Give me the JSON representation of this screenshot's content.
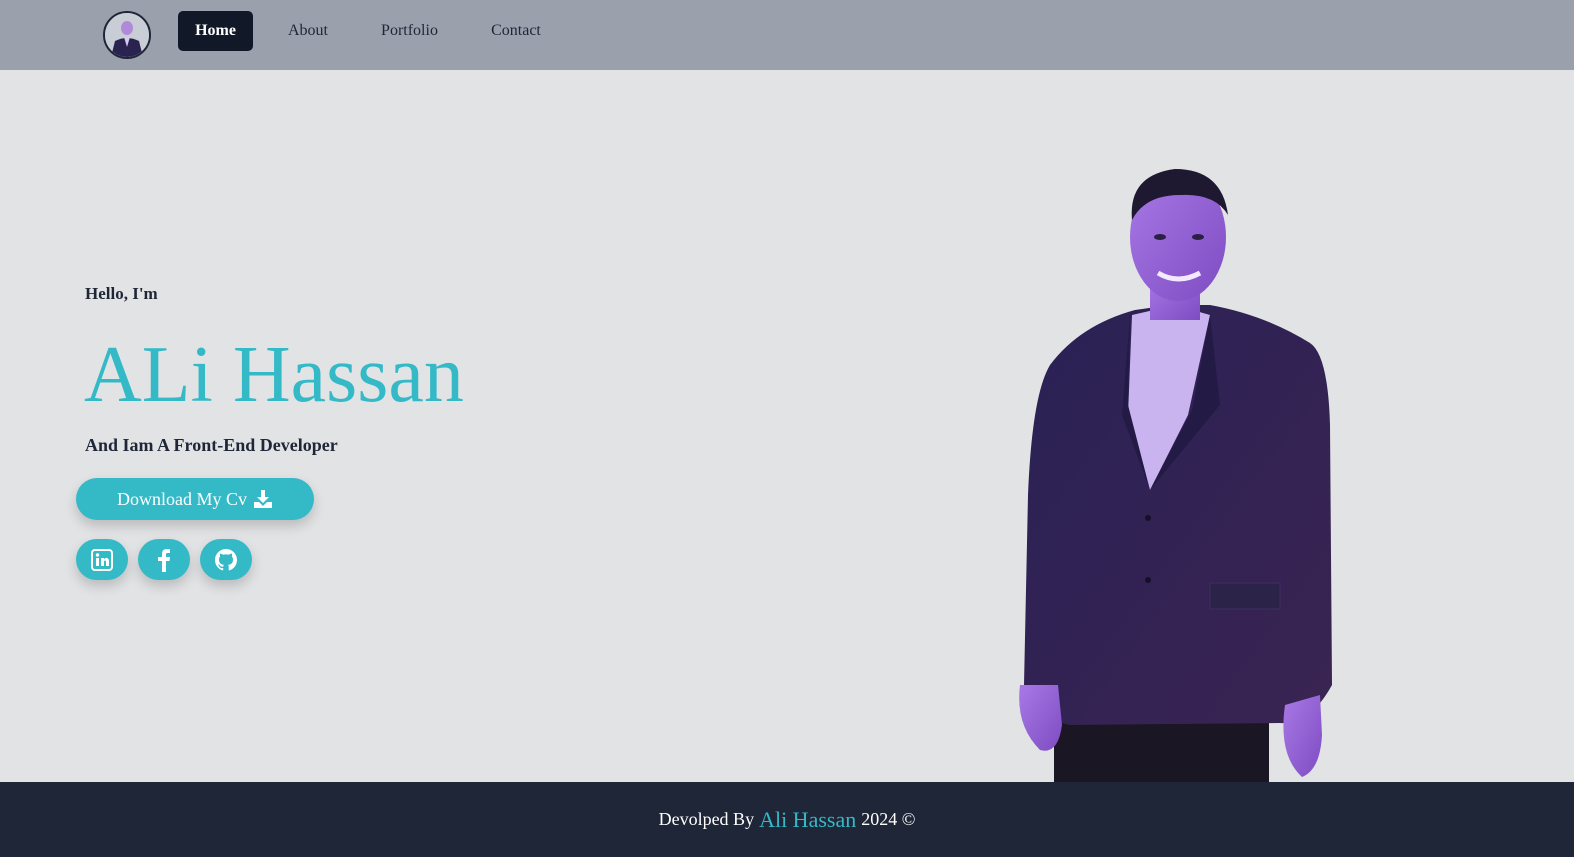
{
  "colors": {
    "accent": "#34b9c7",
    "navbar": "#9aa1ad",
    "background": "#e2e3e5",
    "dark": "#1e2637",
    "active_nav": "#111827"
  },
  "nav": {
    "avatar_icon": "profile-photo",
    "items": [
      {
        "label": "Home",
        "active": true
      },
      {
        "label": "About",
        "active": false
      },
      {
        "label": "Portfolio",
        "active": false
      },
      {
        "label": "Contact",
        "active": false
      }
    ]
  },
  "hero": {
    "greeting": "Hello, I'm",
    "name": "ALi Hassan",
    "tagline": "And Iam A Front-End Developer",
    "cv_button": {
      "label": "Download My Cv",
      "icon": "download-icon"
    },
    "social": [
      {
        "icon": "linkedin-icon"
      },
      {
        "icon": "facebook-icon"
      },
      {
        "icon": "github-icon"
      }
    ],
    "portrait_icon": "portrait-photo"
  },
  "footer": {
    "prefix": "Devolped By",
    "name": "Ali Hassan",
    "suffix": "2024 ©"
  }
}
